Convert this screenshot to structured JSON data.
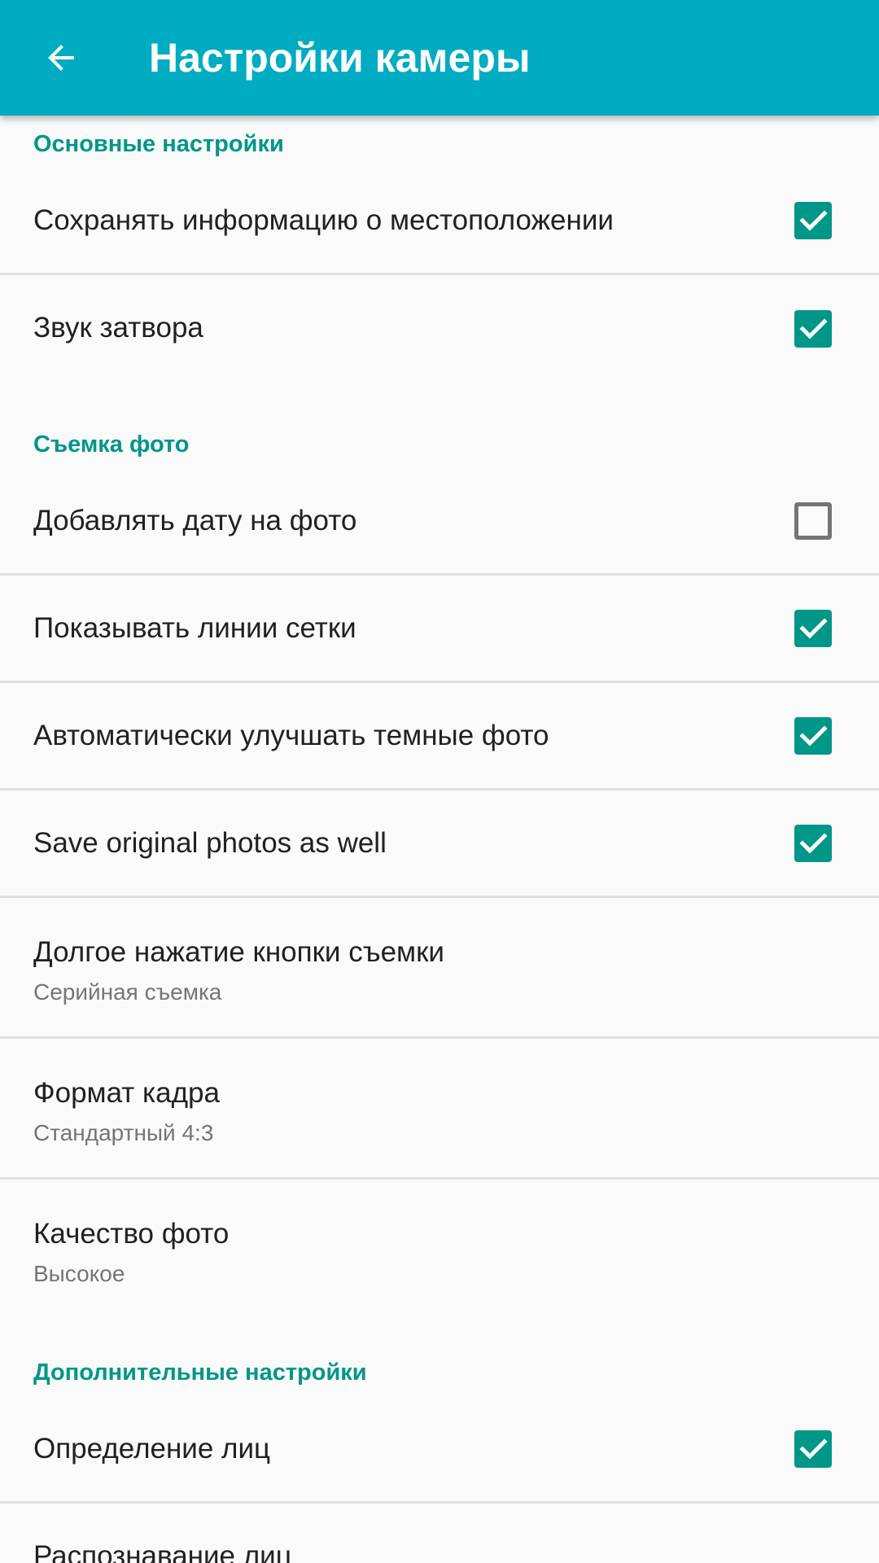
{
  "toolbar": {
    "title": "Настройки камеры",
    "back_icon": "arrow-back-icon",
    "background_color": "#00ACC1"
  },
  "colors": {
    "accent": "#009688",
    "category_text": "#009688",
    "primary_text": "#212121",
    "secondary_text": "#757575"
  },
  "sections": [
    {
      "title": "Основные настройки",
      "items": [
        {
          "title": "Сохранять информацию о местоположении",
          "checked": true
        },
        {
          "title": "Звук затвора",
          "checked": true
        }
      ]
    },
    {
      "title": "Съемка фото",
      "items": [
        {
          "title": "Добавлять дату на фото",
          "checked": false
        },
        {
          "title": "Показывать линии сетки",
          "checked": true
        },
        {
          "title": "Автоматически улучшать темные фото",
          "checked": true
        },
        {
          "title": "Save original photos as well",
          "checked": true
        },
        {
          "title": "Долгое нажатие кнопки съемки",
          "summary": "Серийная съемка"
        },
        {
          "title": "Формат кадра",
          "summary": "Стандартный 4:3"
        },
        {
          "title": "Качество фото",
          "summary": "Высокое"
        }
      ]
    },
    {
      "title": "Дополнительные настройки",
      "items": [
        {
          "title": "Определение лиц",
          "checked": true
        },
        {
          "title": "Распознавание лиц"
        }
      ]
    }
  ]
}
